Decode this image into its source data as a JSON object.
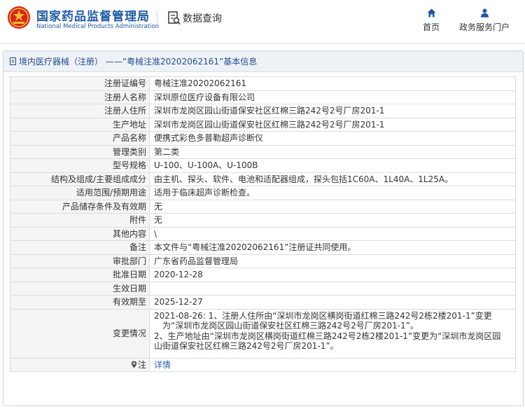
{
  "header": {
    "logo_cn": "国家药品监督管理局",
    "logo_en": "National Medical Products Administration",
    "data_query": "数据查询",
    "nav": {
      "home": "首页",
      "gov_portal": "政务服务门户"
    }
  },
  "panel": {
    "title": "境内医疗器械（注册） ——“粤械注准20202062161”基本信息"
  },
  "fields": [
    {
      "label": "注册证编号",
      "value": "粤械注准20202062161"
    },
    {
      "label": "注册人名称",
      "value": "深圳原位医疗设备有限公司"
    },
    {
      "label": "注册人住所",
      "value": "深圳市龙岗区园山街道保安社区红棉三路242号2号厂房201-1"
    },
    {
      "label": "生产地址",
      "value": "深圳市龙岗区园山街道保安社区红棉三路242号2号厂房201-1"
    },
    {
      "label": "产品名称",
      "value": "便携式彩色多普勒超声诊断仪"
    },
    {
      "label": "管理类别",
      "value": "第二类"
    },
    {
      "label": "型号规格",
      "value": "U-100、U-100A、U-100B"
    },
    {
      "label": "结构及组成/主要组成成分",
      "value": "由主机、探头、软件、电池和适配器组成，探头包括1C60A、1L40A、1L25A。"
    },
    {
      "label": "适用范围/预期用途",
      "value": "适用于临床超声诊断检查。"
    },
    {
      "label": "产品储存条件及有效期",
      "value": "无"
    },
    {
      "label": "附件",
      "value": "无"
    },
    {
      "label": "其他内容",
      "value": "\\"
    },
    {
      "label": "备注",
      "value": "本文件与“粤械注准20202062161”注册证共同使用。"
    },
    {
      "label": "审批部门",
      "value": "广东省药品监督管理局"
    },
    {
      "label": "批准日期",
      "value": "2020-12-28"
    },
    {
      "label": "生效日期",
      "value": ""
    },
    {
      "label": "有效期至",
      "value": "2025-12-27"
    }
  ],
  "change_history": {
    "label": "变更情况",
    "lines": [
      "2021-08-26: 1、注册人住所由“深圳市龙岗区横岗街道红棉三路242号2栋2楼201-1”变更",
      "为“深圳市龙岗区园山街道保安社区红棉三路242号2号厂房201-1”。",
      "2、生产地址由“深圳市龙岗区横岗街道红棉三路242号2栋2楼201-1”变更为“深圳市龙岗区园",
      "山街道保安社区红棉三路242号2号厂房201-1”。"
    ]
  },
  "note": {
    "label": "注",
    "link": "详情"
  },
  "colors": {
    "brand_blue": "#1f5aa6",
    "link_blue": "#2a63b8",
    "emblem_red": "#d9261c",
    "emblem_gold": "#f2c12e"
  },
  "icons": {
    "emblem": "national-emblem-icon",
    "query": "document-search-icon",
    "home": "home-icon",
    "user": "user-icon",
    "title": "document-icon",
    "note": "location-pin-icon"
  }
}
